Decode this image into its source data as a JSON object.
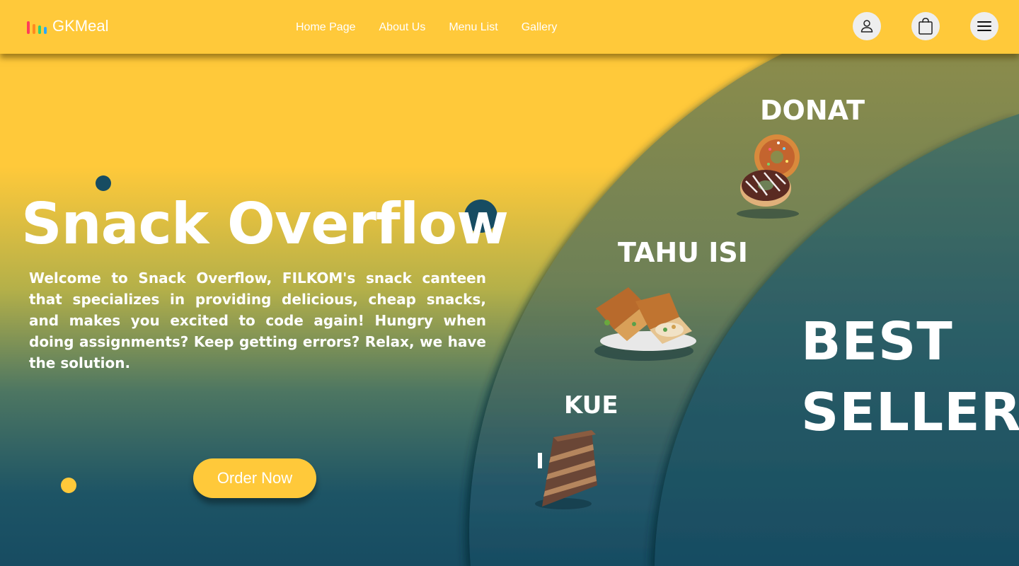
{
  "app": {
    "brand": "GKMeal",
    "logo_colors": [
      "#ff3d5a",
      "#ff8a1e",
      "#2fd07a",
      "#2aa8ff"
    ]
  },
  "nav": {
    "items": [
      "Home Page",
      "About Us",
      "Menu List",
      "Gallery"
    ]
  },
  "header_icons": [
    "user-icon",
    "shopping-bag-icon",
    "menu-icon"
  ],
  "hero": {
    "title": "Snack Overflow",
    "description": "Welcome to Snack Overflow, FILKOM's snack canteen that specializes in providing delicious, cheap snacks, and makes you excited to code again! Hungry when doing assignments? Keep getting errors? Relax, we have the solution.",
    "cta_label": "Order Now"
  },
  "best_seller": {
    "line1": "BEST",
    "line2": "SELLER",
    "items": [
      {
        "label": "DONAT",
        "icon": "donut-image"
      },
      {
        "label": "TAHU ISI",
        "icon": "stuffed-tofu-image"
      },
      {
        "label": "KUE",
        "icon": "cake-slice-image"
      }
    ]
  },
  "colors": {
    "primary_yellow": "#ffc93a",
    "dark_teal": "#174c62",
    "olive": "#8a8c4c",
    "white": "#ffffff"
  }
}
